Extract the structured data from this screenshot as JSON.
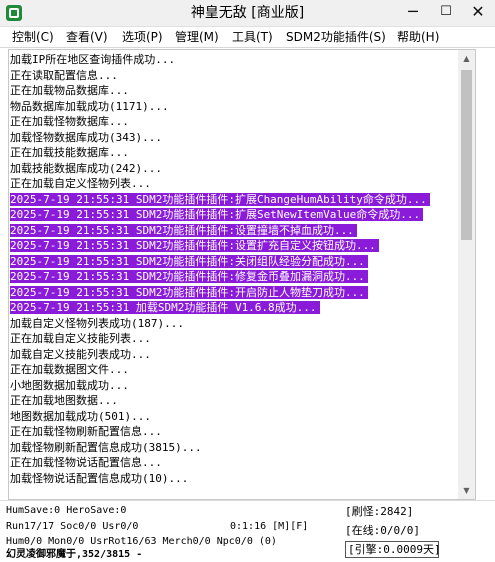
{
  "window": {
    "title": "神皇无敌 [商业版]",
    "minimize": "─",
    "maximize": "☐",
    "close": "✕"
  },
  "menu": [
    "控制(C)",
    "查看(V)",
    "选项(P)",
    "管理(M)",
    "工具(T)",
    "SDM2功能插件(S)",
    "帮助(H)"
  ],
  "log": [
    {
      "text": "加载IP所在地区查询插件成功...",
      "hl": false
    },
    {
      "text": "正在读取配置信息...",
      "hl": false
    },
    {
      "text": "正在加载物品数据库...",
      "hl": false
    },
    {
      "text": "物品数据库加载成功(1171)...",
      "hl": false
    },
    {
      "text": "正在加载怪物数据库...",
      "hl": false
    },
    {
      "text": "加载怪物数据库成功(343)...",
      "hl": false
    },
    {
      "text": "正在加载技能数据库...",
      "hl": false
    },
    {
      "text": "加载技能数据库成功(242)...",
      "hl": false
    },
    {
      "text": "正在加载自定义怪物列表...",
      "hl": false
    },
    {
      "text": "2025-7-19 21:55:31 SDM2功能插件插件:扩展ChangeHumAbility命令成功...",
      "hl": true
    },
    {
      "text": "2025-7-19 21:55:31 SDM2功能插件插件:扩展SetNewItemValue命令成功...",
      "hl": true
    },
    {
      "text": "2025-7-19 21:55:31 SDM2功能插件插件:设置撞墙不掉血成功...",
      "hl": true
    },
    {
      "text": "2025-7-19 21:55:31 SDM2功能插件插件:设置扩充自定义按钮成功...",
      "hl": true
    },
    {
      "text": "2025-7-19 21:55:31 SDM2功能插件插件:关闭组队经验分配成功...",
      "hl": true
    },
    {
      "text": "2025-7-19 21:55:31 SDM2功能插件插件:修复金币叠加漏洞成功...",
      "hl": true
    },
    {
      "text": "2025-7-19 21:55:31 SDM2功能插件插件:开启防止人物垫刀成功...",
      "hl": true
    },
    {
      "text": "2025-7-19 21:55:31 加载SDM2功能插件 V1.6.8成功...",
      "hl": true
    },
    {
      "text": "加载自定义怪物列表成功(187)...",
      "hl": false
    },
    {
      "text": "正在加载自定义技能列表...",
      "hl": false
    },
    {
      "text": "加载自定义技能列表成功...",
      "hl": false
    },
    {
      "text": "正在加载数据图文件...",
      "hl": false
    },
    {
      "text": "小地图数据加载成功...",
      "hl": false
    },
    {
      "text": "正在加载地图数据...",
      "hl": false
    },
    {
      "text": "地图数据加载成功(501)...",
      "hl": false
    },
    {
      "text": "正在加载怪物刷新配置信息...",
      "hl": false
    },
    {
      "text": "加载怪物刷新配置信息成功(3815)...",
      "hl": false
    },
    {
      "text": "正在加载怪物说话配置信息...",
      "hl": false
    },
    {
      "text": "加载怪物说话配置信息成功(10)...",
      "hl": false
    }
  ],
  "status": {
    "line1": "HumSave:0 HeroSave:0",
    "line2_left": "Run17/17 Soc0/0 Usr0/0",
    "line2_time": "0:1:16 [M][F]",
    "line3": "Hum0/0 Mon0/0 UsrRot16/63 Merch0/0 Npc0/0 (0)",
    "line4": "幻灵凌御邪魔于,352/3815 -",
    "refresh": "[刷怪:2842]",
    "online": "[在线:0/0/0]",
    "engine": "[引擎:0.0009天]"
  }
}
